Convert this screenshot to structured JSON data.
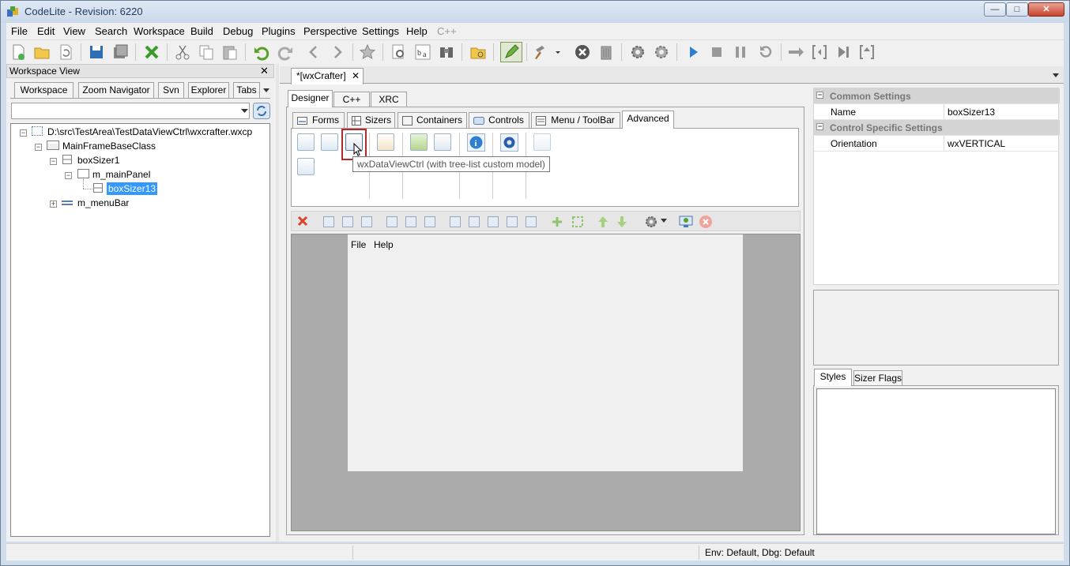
{
  "window": {
    "title": "CodeLite - Revision: 6220",
    "minimize": "—",
    "maximize": "□",
    "close": "✕"
  },
  "menu": [
    "File",
    "Edit",
    "View",
    "Search",
    "Workspace",
    "Build",
    "Debug",
    "Plugins",
    "Perspective",
    "Settings",
    "Help",
    "C++"
  ],
  "workspace_panel": {
    "title": "Workspace View",
    "close": "✕",
    "tabs": [
      "Workspace",
      "Zoom Navigator",
      "Svn",
      "Explorer",
      "Tabs"
    ],
    "tree": [
      {
        "label": "D:\\src\\TestArea\\TestDataViewCtrl\\wxcrafter.wxcp",
        "expander": "−"
      },
      {
        "label": "MainFrameBaseClass",
        "expander": "−"
      },
      {
        "label": "boxSizer1",
        "expander": "−"
      },
      {
        "label": "m_mainPanel",
        "expander": "−"
      },
      {
        "label": "boxSizer13",
        "expander": ""
      },
      {
        "label": "m_menuBar",
        "expander": "+"
      }
    ]
  },
  "editor": {
    "doc_tab": "*[wxCrafter]",
    "doc_tab_close": "✕",
    "view_tabs": [
      "Designer",
      "C++",
      "XRC"
    ],
    "palette_tabs": [
      "Forms",
      "Sizers",
      "Containers",
      "Controls",
      "Menu / ToolBar",
      "Advanced"
    ],
    "tooltip": "wxDataViewCtrl (with tree-list custom model)",
    "form_menu": [
      "File",
      "Help"
    ]
  },
  "properties": {
    "categories": [
      {
        "title": "Common Settings",
        "rows": [
          {
            "name": "Name",
            "value": "boxSizer13"
          }
        ]
      },
      {
        "title": "Control Specific Settings",
        "rows": [
          {
            "name": "Orientation",
            "value": "wxVERTICAL"
          }
        ]
      }
    ],
    "bottom_tabs": [
      "Styles",
      "Sizer Flags"
    ]
  },
  "status": {
    "env": "Env: Default, Dbg: Default"
  },
  "colors": {
    "selection": "#3399ff",
    "accent_red": "#c0392b",
    "green": "#3a9a2a"
  }
}
